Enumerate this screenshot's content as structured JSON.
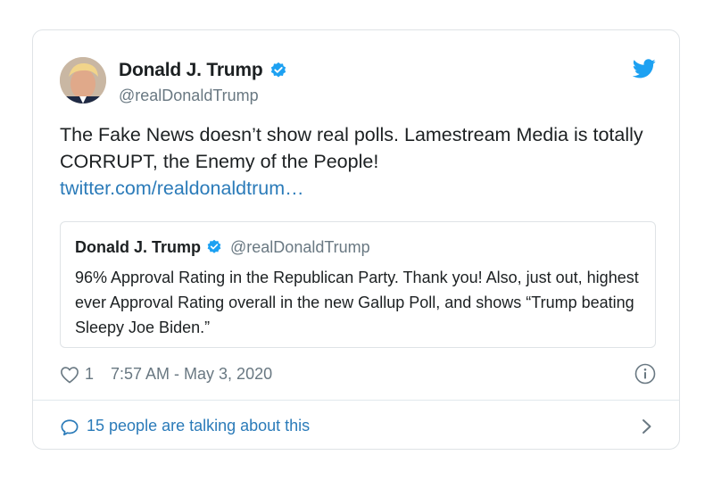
{
  "author": {
    "name": "Donald J. Trump",
    "handle": "@realDonaldTrump",
    "verified": true
  },
  "tweet": {
    "text": "The Fake News doesn’t show real polls. Lamestream Media is totally CORRUPT, the Enemy of the People!",
    "link": "twitter.com/realdonaldtrum…"
  },
  "quoted_tweet": {
    "name": "Donald J. Trump",
    "handle": "@realDonaldTrump",
    "text": "96% Approval Rating in the Republican Party. Thank you! Also, just out, highest ever Approval Rating overall in the new Gallup Poll, and shows “Trump beating Sleepy Joe Biden.”"
  },
  "meta": {
    "likes": "1",
    "timestamp": "7:57 AM - May 3, 2020"
  },
  "footer": {
    "talking": "15 people are talking about this"
  },
  "colors": {
    "link": "#2b7bb9",
    "verified": "#1da1f2",
    "secondary_text": "#697882",
    "border": "#dfe3e6"
  },
  "icons": [
    "twitter-bird-icon",
    "verified-badge-icon",
    "heart-icon",
    "info-icon",
    "comment-bubble-icon",
    "chevron-right-icon"
  ]
}
